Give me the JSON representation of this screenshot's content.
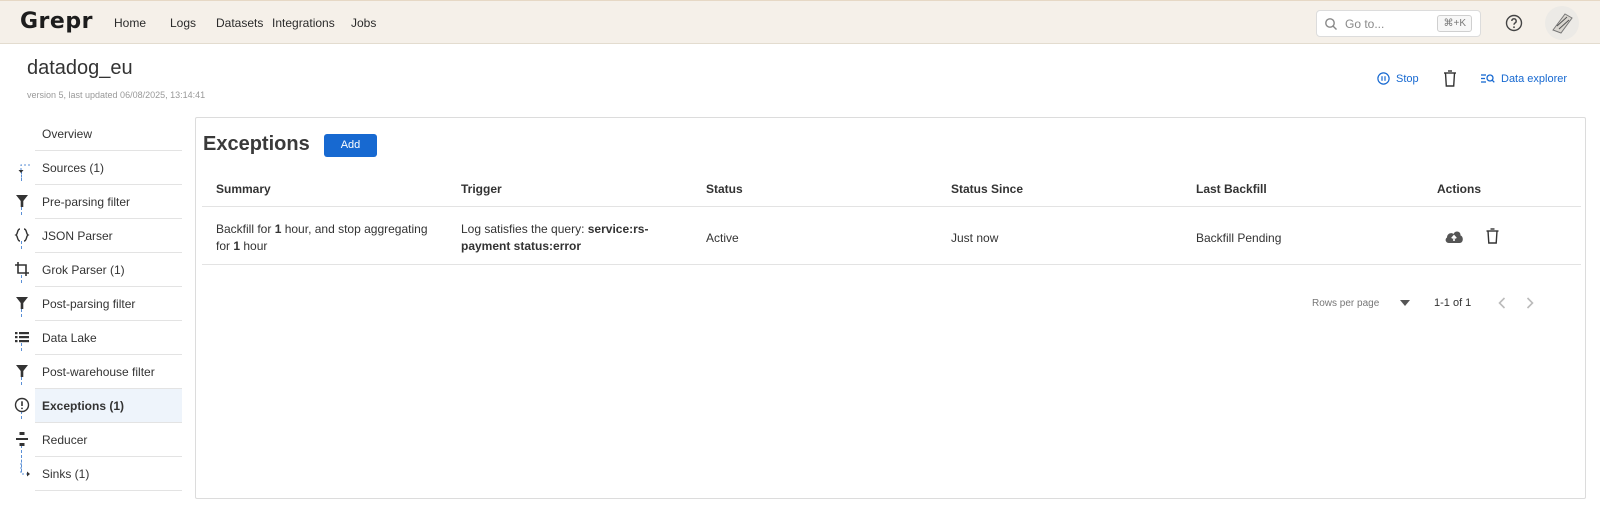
{
  "app": {
    "logo": "Grepr"
  },
  "nav": {
    "items": [
      "Home",
      "Logs",
      "Datasets",
      "Integrations",
      "Jobs"
    ]
  },
  "search": {
    "placeholder": "Go to...",
    "shortcut": "⌘+K"
  },
  "page": {
    "title": "datadog_eu",
    "subtitle": "version 5, last updated 06/08/2025, 13:14:41",
    "actions": {
      "stop": "Stop",
      "data_explorer": "Data explorer"
    }
  },
  "sidebar": {
    "items": [
      {
        "label": "Overview",
        "icon": "none"
      },
      {
        "label": "Sources (1)",
        "icon": "dotted-arrow-icon"
      },
      {
        "label": "Pre-parsing filter",
        "icon": "filter-icon"
      },
      {
        "label": "JSON Parser",
        "icon": "braces-icon"
      },
      {
        "label": "Grok Parser (1)",
        "icon": "crop-icon"
      },
      {
        "label": "Post-parsing filter",
        "icon": "filter-icon"
      },
      {
        "label": "Data Lake",
        "icon": "list-icon"
      },
      {
        "label": "Post-warehouse filter",
        "icon": "filter-icon"
      },
      {
        "label": "Exceptions (1)",
        "icon": "alert-circle-icon"
      },
      {
        "label": "Reducer",
        "icon": "divide-icon"
      },
      {
        "label": "Sinks (1)",
        "icon": "dotted-arrow-end-icon"
      }
    ],
    "active": "Exceptions (1)"
  },
  "exceptions": {
    "title": "Exceptions",
    "add_label": "Add",
    "columns": [
      "Summary",
      "Trigger",
      "Status",
      "Status Since",
      "Last Backfill",
      "Actions"
    ],
    "rows": [
      {
        "summary_parts": [
          "Backfill for ",
          "1",
          " hour, and stop aggregating for ",
          "1",
          " hour"
        ],
        "trigger_prefix": "Log satisfies the query: ",
        "trigger_query": "service:rs-payment status:error",
        "status": "Active",
        "status_since": "Just now",
        "last_backfill": "Backfill Pending"
      }
    ],
    "footer": {
      "rows_per_page_label": "Rows per page",
      "range": "1-1 of 1"
    }
  },
  "colors": {
    "accent": "#1769d1",
    "topbar": "#f5f0e9",
    "active_bg": "#eef4fb"
  }
}
